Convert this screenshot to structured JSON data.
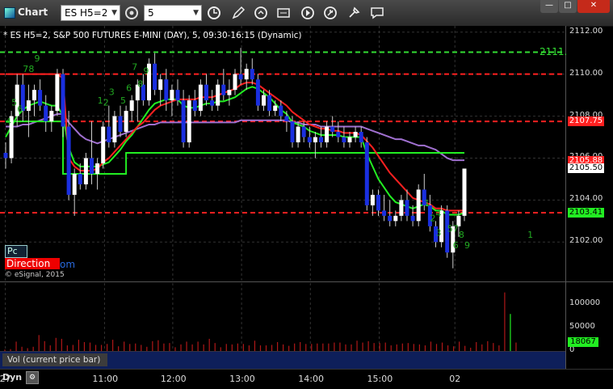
{
  "window": {
    "app_title": "Chart",
    "symbol": "ES H5=2",
    "interval": "5",
    "toolbar_icons": [
      "clock-icon",
      "pencil-icon",
      "refresh-icon",
      "quote-icon",
      "play-icon",
      "pin-icon",
      "tools-icon",
      "comment-icon"
    ]
  },
  "chart_info": "* ES H5=2, S&P 500 FUTURES E-MINI (DAY), 5, 09:30-16:15 (Dynamic)",
  "panel_buttons": {
    "pc": "Pc",
    "direction": "Direction",
    "direction_suffix": "om"
  },
  "copyright": "© eSignal, 2015",
  "volume_label": "Vol (current price bar)",
  "dyn_label": "Dyn",
  "colors": {
    "up": "#ffffff",
    "down": "#1a2fe0",
    "ema_red": "#ff2020",
    "ema_green": "#22ee22",
    "ma_purple": "#a070d0",
    "seq": "#22aa22",
    "volume_bar": "#b01818"
  },
  "chart_data": {
    "type": "candlestick",
    "price_axis": {
      "ticks": [
        "2112.00",
        "2110.00",
        "2108.00",
        "2106.00",
        "2104.00",
        "2102.00"
      ],
      "ylim": [
        2100.2,
        2112.3
      ]
    },
    "price_boxes": [
      {
        "label": "2111.",
        "value": 2111.05,
        "bg": "#000000",
        "fg": "#33dd33"
      },
      {
        "label": "2107.75",
        "value": 2107.75,
        "bg": "#ff2020",
        "fg": "#ffffff"
      },
      {
        "label": "2105.88",
        "value": 2105.88,
        "bg": "#ff2020",
        "fg": "#ffffff"
      },
      {
        "label": "2105.50",
        "value": 2105.5,
        "bg": "#ffffff",
        "fg": "#000000"
      },
      {
        "label": "2103.41",
        "value": 2103.41,
        "bg": "#22ee22",
        "fg": "#000000"
      }
    ],
    "levels": [
      {
        "value": 2111.05,
        "color": "#33dd33"
      },
      {
        "value": 2110.0,
        "color": "#ff2020"
      },
      {
        "value": 2107.75,
        "color": "#ff2020"
      },
      {
        "value": 2103.4,
        "color": "#ff2020"
      }
    ],
    "time_labels": [
      "27",
      "11:00",
      "12:00",
      "13:00",
      "14:00",
      "15:00",
      "02"
    ],
    "time_label_bars": [
      -0.2,
      17.1,
      29,
      41,
      53,
      65,
      78.2
    ],
    "bar_step": 7.1,
    "first_bar_x": 7,
    "ohlc": [
      [
        2106.25,
        2106.75,
        2105.5,
        2106.0
      ],
      [
        2106.0,
        2108.25,
        2105.75,
        2108.0
      ],
      [
        2108.0,
        2110.0,
        2107.5,
        2109.5
      ],
      [
        2109.5,
        2110.0,
        2107.75,
        2108.25
      ],
      [
        2108.25,
        2109.5,
        2107.0,
        2108.75
      ],
      [
        2108.75,
        2109.5,
        2108.0,
        2109.25
      ],
      [
        2109.25,
        2109.75,
        2108.25,
        2108.5
      ],
      [
        2108.5,
        2109.0,
        2107.25,
        2107.75
      ],
      [
        2107.75,
        2108.5,
        2107.25,
        2108.25
      ],
      [
        2108.25,
        2110.25,
        2108.0,
        2110.0
      ],
      [
        2110.0,
        2110.25,
        2107.0,
        2107.5
      ],
      [
        2107.5,
        2108.25,
        2104.0,
        2104.25
      ],
      [
        2104.25,
        2105.5,
        2103.25,
        2105.25
      ],
      [
        2105.25,
        2105.75,
        2104.5,
        2104.75
      ],
      [
        2104.75,
        2106.25,
        2104.5,
        2106.0
      ],
      [
        2106.0,
        2107.75,
        2104.75,
        2105.25
      ],
      [
        2105.25,
        2106.0,
        2104.5,
        2105.75
      ],
      [
        2105.75,
        2107.75,
        2105.5,
        2107.5
      ],
      [
        2107.5,
        2108.5,
        2106.5,
        2106.75
      ],
      [
        2106.75,
        2108.25,
        2106.5,
        2108.0
      ],
      [
        2108.0,
        2108.5,
        2107.0,
        2107.25
      ],
      [
        2107.25,
        2108.5,
        2107.0,
        2108.25
      ],
      [
        2108.25,
        2109.0,
        2107.75,
        2108.75
      ],
      [
        2108.75,
        2109.75,
        2107.75,
        2109.5
      ],
      [
        2109.5,
        2110.0,
        2108.5,
        2108.75
      ],
      [
        2108.75,
        2110.75,
        2108.5,
        2110.5
      ],
      [
        2110.5,
        2111.0,
        2109.0,
        2109.25
      ],
      [
        2109.25,
        2110.0,
        2108.5,
        2109.75
      ],
      [
        2109.75,
        2110.25,
        2108.25,
        2108.75
      ],
      [
        2108.75,
        2109.5,
        2108.0,
        2109.25
      ],
      [
        2109.25,
        2109.75,
        2108.5,
        2108.75
      ],
      [
        2108.75,
        2109.25,
        2106.5,
        2106.75
      ],
      [
        2106.75,
        2109.0,
        2106.5,
        2108.75
      ],
      [
        2108.75,
        2109.25,
        2108.0,
        2108.25
      ],
      [
        2108.25,
        2109.75,
        2108.0,
        2109.5
      ],
      [
        2109.5,
        2110.0,
        2108.5,
        2108.75
      ],
      [
        2108.75,
        2109.25,
        2108.25,
        2108.5
      ],
      [
        2108.5,
        2109.75,
        2108.25,
        2109.5
      ],
      [
        2109.5,
        2110.25,
        2108.75,
        2109.0
      ],
      [
        2109.0,
        2109.75,
        2108.5,
        2109.25
      ],
      [
        2109.25,
        2110.25,
        2109.0,
        2110.0
      ],
      [
        2110.0,
        2111.25,
        2109.5,
        2109.75
      ],
      [
        2109.75,
        2110.5,
        2109.25,
        2110.25
      ],
      [
        2110.25,
        2110.75,
        2109.5,
        2109.75
      ],
      [
        2109.75,
        2110.0,
        2108.25,
        2108.5
      ],
      [
        2108.5,
        2109.25,
        2108.25,
        2109.0
      ],
      [
        2109.0,
        2109.25,
        2108.0,
        2108.25
      ],
      [
        2108.25,
        2108.75,
        2108.0,
        2108.5
      ],
      [
        2108.5,
        2108.75,
        2107.75,
        2108.0
      ],
      [
        2108.0,
        2108.25,
        2107.25,
        2107.75
      ],
      [
        2107.75,
        2108.0,
        2106.5,
        2106.75
      ],
      [
        2106.75,
        2107.75,
        2106.5,
        2107.5
      ],
      [
        2107.5,
        2107.75,
        2106.75,
        2107.0
      ],
      [
        2107.0,
        2107.5,
        2106.5,
        2106.75
      ],
      [
        2106.75,
        2107.25,
        2106.0,
        2107.0
      ],
      [
        2107.0,
        2107.5,
        2106.5,
        2106.75
      ],
      [
        2106.75,
        2107.75,
        2106.5,
        2107.5
      ],
      [
        2107.5,
        2108.0,
        2107.0,
        2107.25
      ],
      [
        2107.25,
        2107.75,
        2106.75,
        2107.0
      ],
      [
        2107.0,
        2107.5,
        2106.5,
        2106.75
      ],
      [
        2106.75,
        2107.25,
        2106.5,
        2107.0
      ],
      [
        2107.0,
        2107.5,
        2106.75,
        2107.25
      ],
      [
        2107.25,
        2107.5,
        2106.5,
        2106.75
      ],
      [
        2106.75,
        2107.0,
        2103.5,
        2103.75
      ],
      [
        2103.75,
        2104.5,
        2103.25,
        2104.25
      ],
      [
        2104.25,
        2104.5,
        2103.25,
        2103.5
      ],
      [
        2103.5,
        2104.25,
        2103.0,
        2103.25
      ],
      [
        2103.25,
        2104.0,
        2102.75,
        2103.0
      ],
      [
        2103.0,
        2103.5,
        2102.75,
        2103.25
      ],
      [
        2103.25,
        2104.25,
        2103.0,
        2104.0
      ],
      [
        2104.0,
        2104.5,
        2103.0,
        2103.25
      ],
      [
        2103.25,
        2103.75,
        2102.75,
        2103.0
      ],
      [
        2103.0,
        2104.75,
        2102.75,
        2104.5
      ],
      [
        2104.5,
        2105.25,
        2103.5,
        2103.75
      ],
      [
        2103.75,
        2104.25,
        2102.5,
        2102.75
      ],
      [
        2102.75,
        2103.0,
        2101.75,
        2102.0
      ],
      [
        2102.0,
        2103.75,
        2101.75,
        2103.5
      ],
      [
        2103.5,
        2103.75,
        2101.25,
        2101.5
      ],
      [
        2101.5,
        2103.0,
        2100.75,
        2102.75
      ],
      [
        2102.75,
        2103.5,
        2102.25,
        2103.25
      ],
      [
        2103.25,
        2105.5,
        2103.0,
        2105.5
      ]
    ],
    "ema_red": [
      2110.0,
      2110.0,
      2110.0,
      2110.0,
      2110.0,
      2110.0,
      2110.0,
      2110.0,
      2110.0,
      2110.0,
      2109.8,
      2106.0,
      2105.6,
      2105.4,
      2105.4,
      2105.4,
      2105.5,
      2105.8,
      2106.0,
      2106.3,
      2106.6,
      2106.9,
      2107.2,
      2107.5,
      2107.7,
      2108.0,
      2108.3,
      2108.5,
      2108.6,
      2108.7,
      2108.8,
      2108.8,
      2108.8,
      2108.8,
      2108.9,
      2108.9,
      2108.9,
      2109.0,
      2109.1,
      2109.2,
      2109.3,
      2109.5,
      2109.6,
      2109.6,
      2109.5,
      2109.3,
      2109.1,
      2108.9,
      2108.7,
      2108.5,
      2108.2,
      2108.0,
      2107.8,
      2107.6,
      2107.5,
      2107.4,
      2107.4,
      2107.3,
      2107.3,
      2107.2,
      2107.2,
      2107.2,
      2107.1,
      2106.8,
      2106.5,
      2106.1,
      2105.7,
      2105.3,
      2105.0,
      2104.7,
      2104.4,
      2104.1,
      2104.0,
      2103.9,
      2103.8,
      2103.6,
      2103.6,
      2103.5,
      2103.5,
      2103.5,
      2103.5
    ],
    "ema_green": [
      2107.0,
      2107.5,
      2108.0,
      2108.3,
      2108.5,
      2108.6,
      2108.7,
      2108.6,
      2108.5,
      2108.5,
      2108.0,
      2106.5,
      2105.8,
      2105.6,
      2105.6,
      2105.6,
      2105.6,
      2105.7,
      2105.8,
      2106.1,
      2106.4,
      2106.8,
      2107.1,
      2107.5,
      2107.9,
      2108.3,
      2108.6,
      2108.7,
      2108.8,
      2108.8,
      2108.8,
      2108.5,
      2108.4,
      2108.4,
      2108.5,
      2108.6,
      2108.6,
      2108.7,
      2108.7,
      2108.8,
      2108.9,
      2109.1,
      2109.3,
      2109.4,
      2109.3,
      2109.1,
      2108.9,
      2108.6,
      2108.3,
      2108.1,
      2107.7,
      2107.6,
      2107.5,
      2107.3,
      2107.2,
      2107.1,
      2107.1,
      2107.1,
      2107.1,
      2107.0,
      2107.0,
      2107.0,
      2107.0,
      2106.2,
      2105.6,
      2105.0,
      2104.6,
      2104.2,
      2103.9,
      2103.8,
      2103.7,
      2103.6,
      2103.7,
      2103.8,
      2103.7,
      2103.5,
      2103.5,
      2103.3,
      2103.3,
      2103.3,
      2103.4
    ],
    "ma_purple": [
      2107.5,
      2107.5,
      2107.5,
      2107.6,
      2107.6,
      2107.7,
      2107.8,
      2107.9,
      2108.0,
      2108.1,
      2108.1,
      2107.7,
      2107.4,
      2107.1,
      2106.9,
      2106.8,
      2106.7,
      2106.8,
      2106.9,
      2107.0,
      2107.1,
      2107.2,
      2107.3,
      2107.4,
      2107.5,
      2107.6,
      2107.6,
      2107.7,
      2107.7,
      2107.7,
      2107.7,
      2107.7,
      2107.7,
      2107.7,
      2107.7,
      2107.7,
      2107.7,
      2107.7,
      2107.7,
      2107.7,
      2107.7,
      2107.8,
      2107.8,
      2107.8,
      2107.8,
      2107.8,
      2107.8,
      2107.8,
      2107.8,
      2107.8,
      2107.7,
      2107.7,
      2107.6,
      2107.6,
      2107.6,
      2107.5,
      2107.5,
      2107.5,
      2107.5,
      2107.5,
      2107.5,
      2107.5,
      2107.5,
      2107.4,
      2107.3,
      2107.2,
      2107.1,
      2107.0,
      2106.9,
      2106.9,
      2106.8,
      2106.7,
      2106.6,
      2106.6,
      2106.5,
      2106.4,
      2106.2,
      2106.0,
      2105.9,
      2105.9,
      2105.9
    ],
    "ma_steps": [
      {
        "from": 0,
        "to": 9,
        "value": 2107.75
      },
      {
        "from": 9,
        "to": 10,
        "value": 2107.75
      },
      {
        "from": 10,
        "to": 21,
        "value": 2105.25
      },
      {
        "from": 21,
        "to": 52,
        "value": 2106.25
      },
      {
        "from": 52,
        "to": 80,
        "value": 2106.25
      }
    ],
    "seq_labels": [
      {
        "text": "9",
        "bar": 5,
        "price": 2110.6
      },
      {
        "text": "7",
        "bar": 3,
        "price": 2110.1
      },
      {
        "text": "8",
        "bar": 4,
        "price": 2110.1
      },
      {
        "text": "5",
        "bar": 1,
        "price": 2108.5
      },
      {
        "text": "6",
        "bar": 2,
        "price": 2108.2
      },
      {
        "text": "4",
        "bar": 0,
        "price": 2107.6
      },
      {
        "text": "1",
        "bar": 16,
        "price": 2108.6
      },
      {
        "text": "2",
        "bar": 17,
        "price": 2108.5
      },
      {
        "text": "3",
        "bar": 18,
        "price": 2109.0
      },
      {
        "text": "5",
        "bar": 20,
        "price": 2108.6
      },
      {
        "text": "6",
        "bar": 21,
        "price": 2109.2
      },
      {
        "text": "7",
        "bar": 22,
        "price": 2110.2
      },
      {
        "text": "8",
        "bar": 23,
        "price": 2109.4
      },
      {
        "text": "9",
        "bar": 24,
        "price": 2110.0
      },
      {
        "text": "1",
        "bar": 73,
        "price": 2103.7
      },
      {
        "text": "2",
        "bar": 74,
        "price": 2103.0
      },
      {
        "text": "4",
        "bar": 75,
        "price": 2103.2
      },
      {
        "text": "3",
        "bar": 75,
        "price": 2102.3
      },
      {
        "text": "5",
        "bar": 77,
        "price": 2102.5
      },
      {
        "text": "7",
        "bar": 78,
        "price": 2102.5
      },
      {
        "text": "8",
        "bar": 79,
        "price": 2102.2
      },
      {
        "text": "6",
        "bar": 78,
        "price": 2101.7
      },
      {
        "text": "9",
        "bar": 80,
        "price": 2101.7
      },
      {
        "text": "1",
        "bar": 91,
        "price": 2102.2
      }
    ],
    "volume_axis": {
      "ticks": [
        "100000",
        "50000",
        "0"
      ],
      "ylim": [
        0,
        145000
      ],
      "last_label": "18067",
      "last_value": 18067
    },
    "volume": [
      3000,
      4000,
      20000,
      9000,
      6000,
      9000,
      34000,
      21000,
      12000,
      28000,
      26000,
      12000,
      13000,
      24000,
      19000,
      18000,
      13000,
      13000,
      15000,
      24000,
      10000,
      20000,
      15000,
      16000,
      13000,
      9000,
      21000,
      23000,
      16000,
      17000,
      8000,
      14000,
      20000,
      14000,
      20000,
      14000,
      26000,
      17000,
      8000,
      15000,
      14000,
      16000,
      15000,
      12000,
      22000,
      12000,
      12000,
      13000,
      19000,
      14000,
      11000,
      16000,
      19000,
      15000,
      15000,
      16000,
      16000,
      16000,
      18000,
      18000,
      14000,
      14000,
      22000,
      18000,
      21000,
      17000,
      17000,
      18000,
      12000,
      14000,
      16000,
      17000,
      15000,
      14000,
      12000,
      20000,
      15000,
      18000,
      12000,
      10000,
      20000,
      11000,
      7000,
      19000,
      14000,
      21000,
      17000,
      12000,
      125000,
      79000,
      18067
    ]
  }
}
